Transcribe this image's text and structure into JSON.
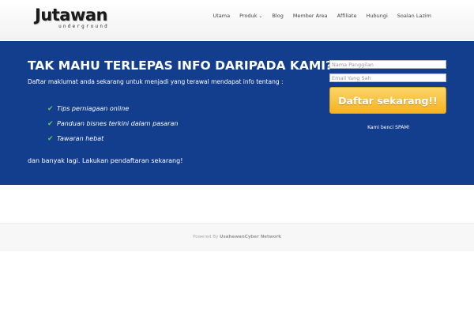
{
  "logo": {
    "main": "Jutawan",
    "sub": "underground"
  },
  "nav": {
    "items": [
      {
        "label": "Utama"
      },
      {
        "label": "Produk",
        "has_dropdown": true
      },
      {
        "label": "Blog"
      },
      {
        "label": "Member Area"
      },
      {
        "label": "Affiliate"
      },
      {
        "label": "Hubungi"
      },
      {
        "label": "Soalan Lazim"
      }
    ]
  },
  "hero": {
    "title": "TAK MAHU TERLEPAS INFO DARIPADA KAMI?",
    "subtitle": "Daftar maklumat anda sekarang untuk menjadi yang terawal mendapat info tentang :",
    "features": [
      "Tips perniagaan online",
      "Panduan bisnes terkini dalam pasaran",
      "Tawaran hebat"
    ],
    "footer": "dan banyak lagi. Lakukan pendaftaran sekarang!",
    "check_color": "#5fd04c",
    "background": "#133e8e"
  },
  "form": {
    "name_placeholder": "Nama Panggilan",
    "email_placeholder": "Email Yang Sah",
    "submit_label": "Daftar sekarang!!",
    "spam_note": "Kami benci SPAM!"
  },
  "footer": {
    "powered_prefix": "Powered By",
    "powered_link": "UsahawanCyber Network"
  }
}
